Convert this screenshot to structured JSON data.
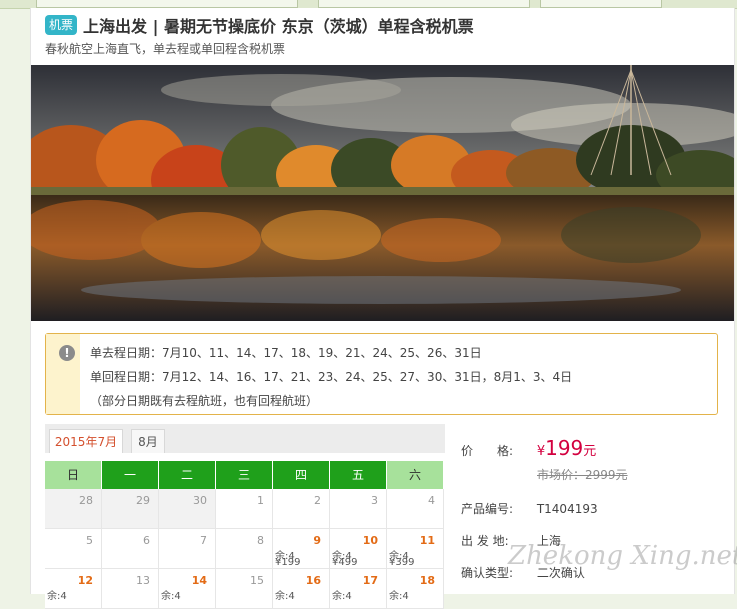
{
  "product": {
    "badge": "机票",
    "title": "上海出发 | 暑期无节操底价 东京（茨城）单程含税机票",
    "subtitle": "春秋航空上海直飞，单去程或单回程含税机票"
  },
  "notice": {
    "icon": "warning-icon",
    "outbound": "单去程日期：7月10、11、14、17、18、19、21、24、25、26、31日",
    "return": "单回程日期：7月12、14、16、17、21、23、24、25、27、30、31日，8月1、3、4日",
    "note": "（部分日期既有去程航班，也有回程航班）"
  },
  "calendar": {
    "tabs": [
      "2015年7月",
      "8月"
    ],
    "weekdays": [
      "日",
      "一",
      "二",
      "三",
      "四",
      "五",
      "六"
    ],
    "rows": [
      [
        {
          "d": "28",
          "past": true
        },
        {
          "d": "29",
          "past": true
        },
        {
          "d": "30",
          "past": true
        },
        {
          "d": "1"
        },
        {
          "d": "2"
        },
        {
          "d": "3"
        },
        {
          "d": "4"
        }
      ],
      [
        {
          "d": "5"
        },
        {
          "d": "6"
        },
        {
          "d": "7"
        },
        {
          "d": "8"
        },
        {
          "d": "9",
          "act": true,
          "rem": "余:4",
          "pr": "¥199"
        },
        {
          "d": "10",
          "act": true,
          "rem": "余:4",
          "pr": "¥499"
        },
        {
          "d": "11",
          "act": true,
          "rem": "余:4",
          "pr": "¥399"
        }
      ],
      [
        {
          "d": "12",
          "act": true,
          "rem": "余:4"
        },
        {
          "d": "13"
        },
        {
          "d": "14",
          "act": true,
          "rem": "余:4"
        },
        {
          "d": "15"
        },
        {
          "d": "16",
          "act": true,
          "rem": "余:4"
        },
        {
          "d": "17",
          "act": true,
          "rem": "余:4"
        },
        {
          "d": "18",
          "act": true,
          "rem": "余:4"
        }
      ]
    ]
  },
  "info": {
    "price_label": "价　　格:",
    "price_symbol": "¥",
    "price_value": "199",
    "price_unit": "元",
    "market_price": "市场价：2999元",
    "code_label": "产品编号:",
    "code_value": "T1404193",
    "origin_label": "出 发 地:",
    "origin_value": "上海",
    "confirm_label": "确认类型:",
    "confirm_value": "二次确认"
  },
  "watermark": "Zhekong Xing.net",
  "colors": {
    "accent": "#1fa01b",
    "price": "#d3003f",
    "badge": "#33b5c8",
    "notice_border": "#e3b34a"
  }
}
